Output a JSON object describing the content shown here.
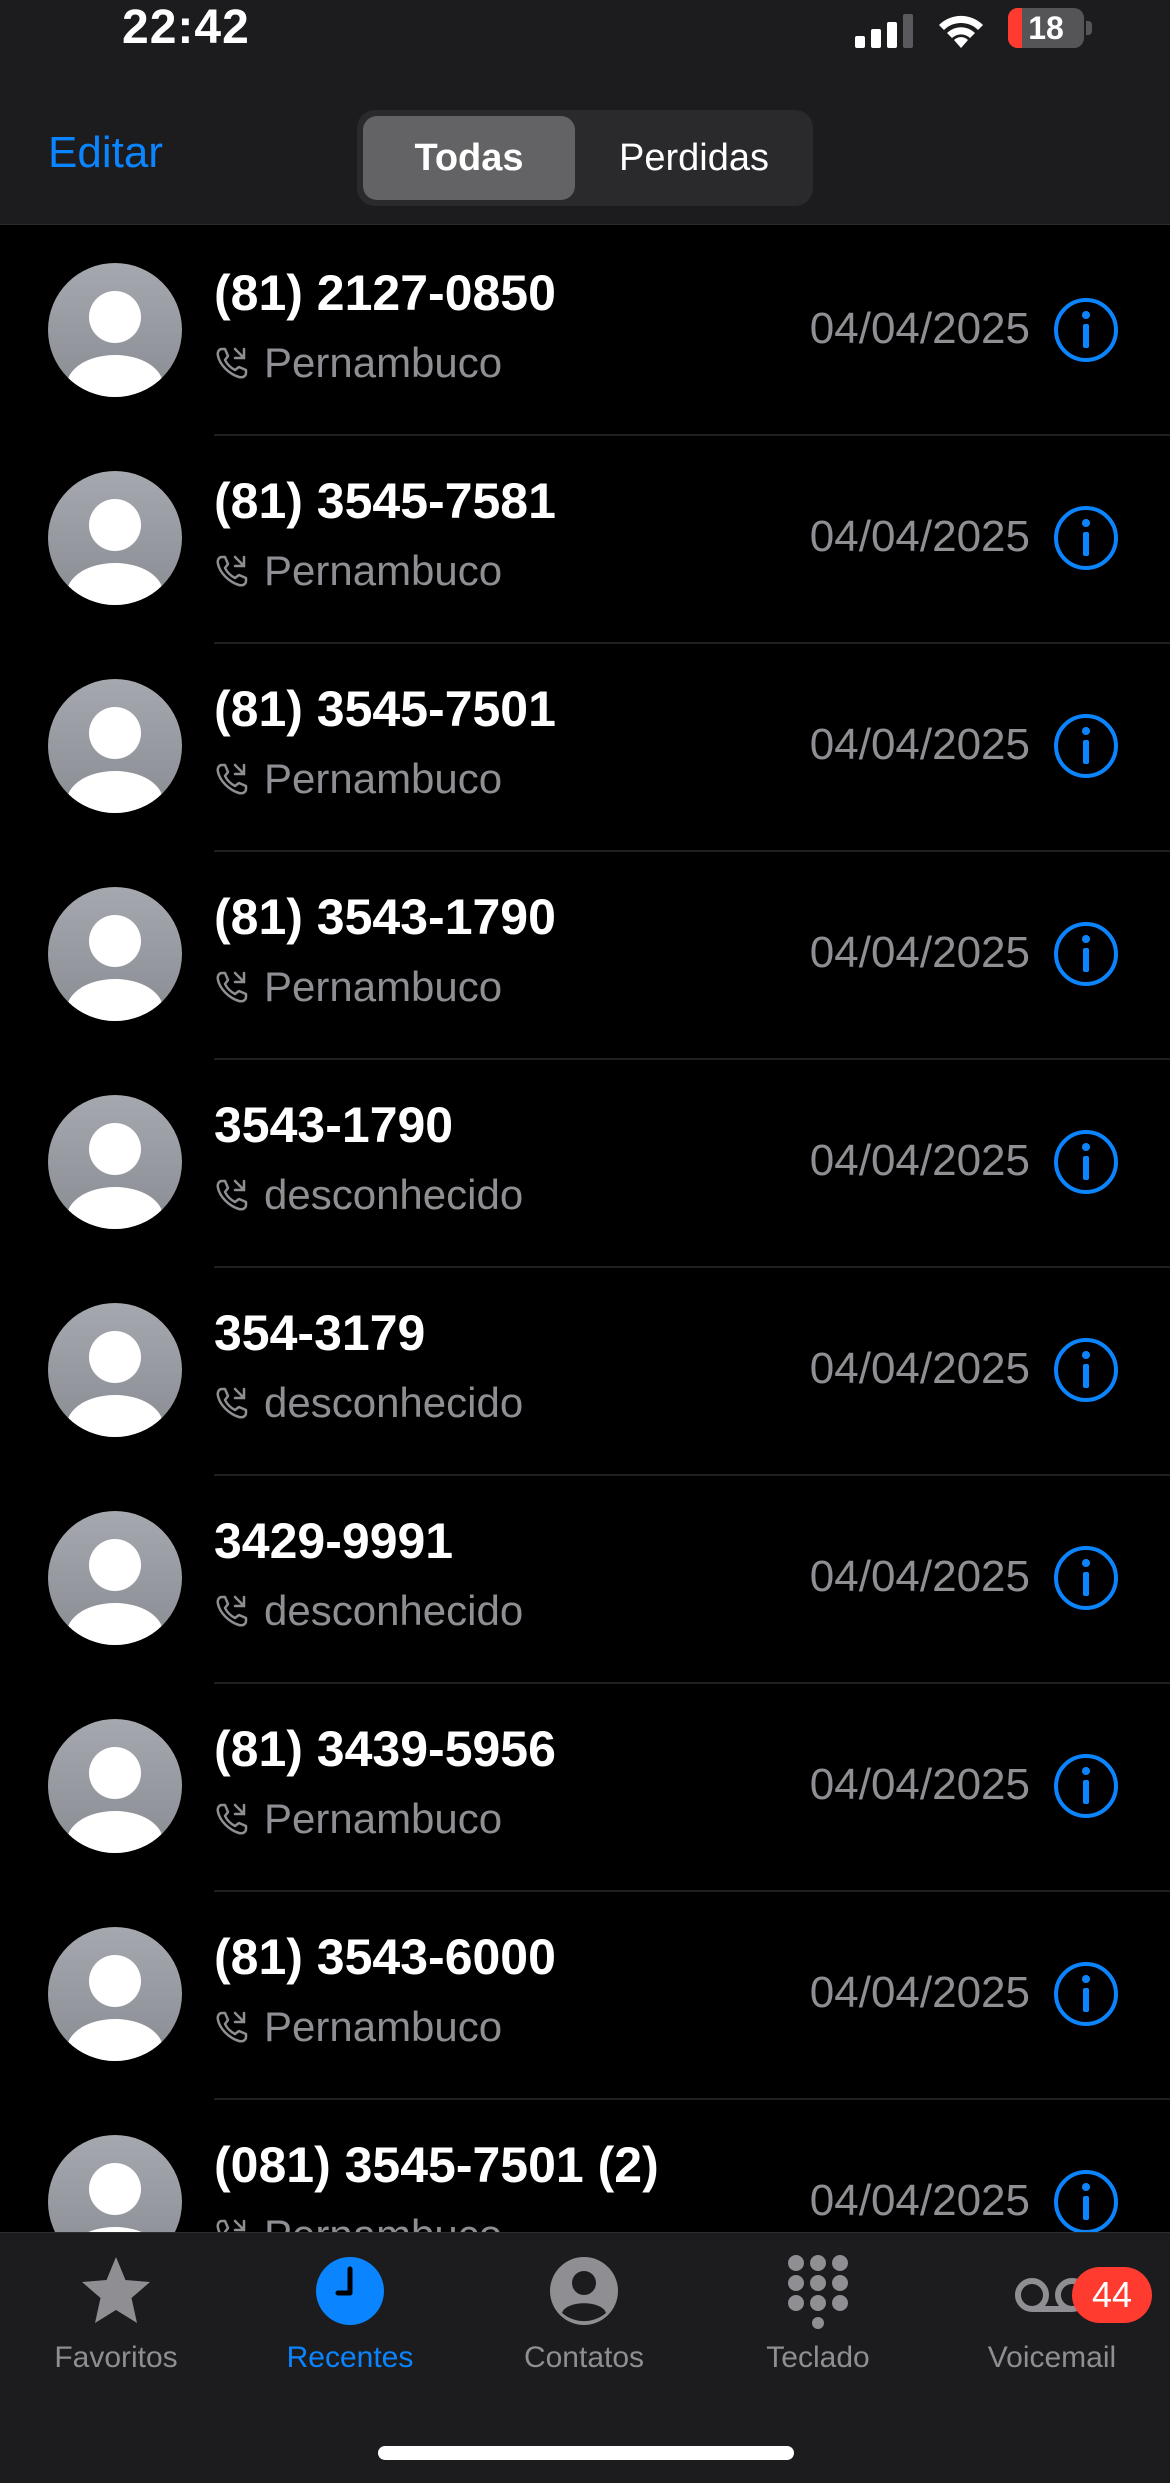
{
  "status_bar": {
    "time": "22:42",
    "battery": "18",
    "battery_level": 0.18
  },
  "header": {
    "edit_label": "Editar",
    "tabs": [
      {
        "label": "Todas",
        "selected": true
      },
      {
        "label": "Perdidas",
        "selected": false
      }
    ]
  },
  "calls": [
    {
      "caller": "(81) 2127-0850",
      "location": "Pernambuco",
      "date": "04/04/2025"
    },
    {
      "caller": "(81) 3545-7581",
      "location": "Pernambuco",
      "date": "04/04/2025"
    },
    {
      "caller": "(81) 3545-7501",
      "location": "Pernambuco",
      "date": "04/04/2025"
    },
    {
      "caller": "(81) 3543-1790",
      "location": "Pernambuco",
      "date": "04/04/2025"
    },
    {
      "caller": "3543-1790",
      "location": "desconhecido",
      "date": "04/04/2025"
    },
    {
      "caller": "354-3179",
      "location": "desconhecido",
      "date": "04/04/2025"
    },
    {
      "caller": "3429-9991",
      "location": "desconhecido",
      "date": "04/04/2025"
    },
    {
      "caller": "(81) 3439-5956",
      "location": "Pernambuco",
      "date": "04/04/2025"
    },
    {
      "caller": "(81) 3543-6000",
      "location": "Pernambuco",
      "date": "04/04/2025"
    },
    {
      "caller": "(081) 3545-7501 (2)",
      "location": "Pernambuco",
      "date": "04/04/2025"
    }
  ],
  "tab_bar": {
    "items": [
      {
        "label": "Favoritos",
        "icon": "star-icon",
        "active": false
      },
      {
        "label": "Recentes",
        "icon": "clock-icon",
        "active": true
      },
      {
        "label": "Contatos",
        "icon": "person-circle-icon",
        "active": false
      },
      {
        "label": "Teclado",
        "icon": "keypad-icon",
        "active": false
      },
      {
        "label": "Voicemail",
        "icon": "voicemail-icon",
        "active": false
      }
    ],
    "voicemail_badge": "44"
  },
  "colors": {
    "accent": "#0a84ff",
    "secondary_text": "#8e8e93",
    "badge": "#ff3b30",
    "background": "#000000"
  }
}
